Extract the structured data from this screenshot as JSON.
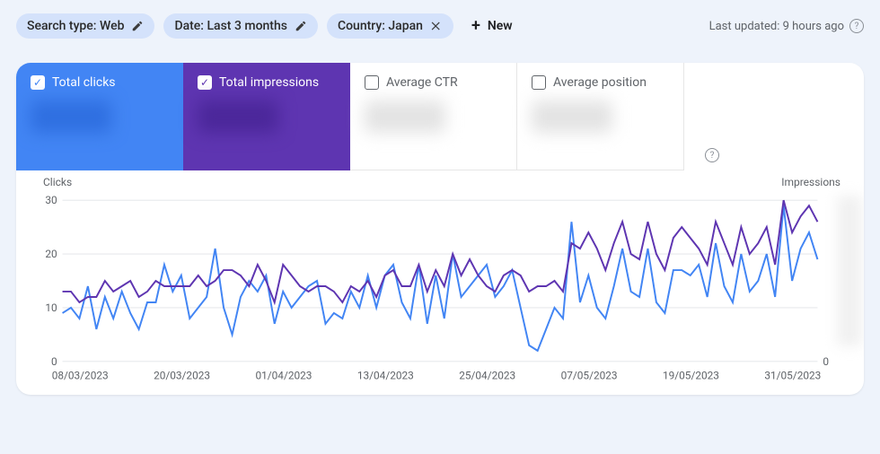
{
  "filters": {
    "search_type": {
      "prefix": "Search type: ",
      "value": "Web"
    },
    "date": {
      "prefix": "Date: ",
      "value": "Last 3 months"
    },
    "country": {
      "prefix": "Country: ",
      "value": "Japan"
    },
    "new_label": "New"
  },
  "status": {
    "last_updated": "Last updated: 9 hours ago"
  },
  "metrics": {
    "clicks": {
      "label": "Total clicks",
      "checked": true,
      "color": "#4285f4"
    },
    "impressions": {
      "label": "Total impressions",
      "checked": true,
      "color": "#5e35b1"
    },
    "ctr": {
      "label": "Average CTR",
      "checked": false
    },
    "position": {
      "label": "Average position",
      "checked": false
    }
  },
  "axes": {
    "left_label": "Clicks",
    "right_label": "Impressions",
    "y_left_ticks": [
      0,
      10,
      20,
      30
    ],
    "y_right_ticks": [
      0
    ],
    "x_ticks": [
      "08/03/2023",
      "20/03/2023",
      "01/04/2023",
      "13/04/2023",
      "25/04/2023",
      "07/05/2023",
      "19/05/2023",
      "31/05/2023"
    ]
  },
  "chart_data": {
    "type": "line",
    "xlabel": "",
    "ylabel": "Clicks",
    "ylim": [
      0,
      30
    ],
    "x": [
      "08/03/2023",
      "09/03/2023",
      "10/03/2023",
      "11/03/2023",
      "12/03/2023",
      "13/03/2023",
      "14/03/2023",
      "15/03/2023",
      "16/03/2023",
      "17/03/2023",
      "18/03/2023",
      "19/03/2023",
      "20/03/2023",
      "21/03/2023",
      "22/03/2023",
      "23/03/2023",
      "24/03/2023",
      "25/03/2023",
      "26/03/2023",
      "27/03/2023",
      "28/03/2023",
      "29/03/2023",
      "30/03/2023",
      "31/03/2023",
      "01/04/2023",
      "02/04/2023",
      "03/04/2023",
      "04/04/2023",
      "05/04/2023",
      "06/04/2023",
      "07/04/2023",
      "08/04/2023",
      "09/04/2023",
      "10/04/2023",
      "11/04/2023",
      "12/04/2023",
      "13/04/2023",
      "14/04/2023",
      "15/04/2023",
      "16/04/2023",
      "17/04/2023",
      "18/04/2023",
      "19/04/2023",
      "20/04/2023",
      "21/04/2023",
      "22/04/2023",
      "23/04/2023",
      "24/04/2023",
      "25/04/2023",
      "26/04/2023",
      "27/04/2023",
      "28/04/2023",
      "29/04/2023",
      "30/04/2023",
      "01/05/2023",
      "02/05/2023",
      "03/05/2023",
      "04/05/2023",
      "05/05/2023",
      "06/05/2023",
      "07/05/2023",
      "08/05/2023",
      "09/05/2023",
      "10/05/2023",
      "11/05/2023",
      "12/05/2023",
      "13/05/2023",
      "14/05/2023",
      "15/05/2023",
      "16/05/2023",
      "17/05/2023",
      "18/05/2023",
      "19/05/2023",
      "20/05/2023",
      "21/05/2023",
      "22/05/2023",
      "23/05/2023",
      "24/05/2023",
      "25/05/2023",
      "26/05/2023",
      "27/05/2023",
      "28/05/2023",
      "29/05/2023",
      "30/05/2023",
      "31/05/2023",
      "01/06/2023",
      "02/06/2023",
      "03/06/2023",
      "04/06/2023",
      "05/06/2023"
    ],
    "series": [
      {
        "name": "Clicks",
        "color": "#4285f4",
        "values": [
          9,
          10,
          8,
          14,
          6,
          12,
          8,
          13,
          9,
          6,
          11,
          11,
          18,
          13,
          16,
          8,
          10,
          12,
          21,
          10,
          5,
          12,
          15,
          13,
          16,
          7,
          13,
          10,
          12,
          14,
          15,
          7,
          9,
          8,
          13,
          10,
          16,
          10,
          16,
          18,
          11,
          8,
          18,
          7,
          16,
          8,
          20,
          12,
          14,
          16,
          18,
          12,
          14,
          17,
          10,
          3,
          2,
          6,
          10,
          8,
          26,
          11,
          16,
          10,
          8,
          14,
          21,
          13,
          12,
          21,
          11,
          9,
          17,
          17,
          16,
          18,
          12,
          22,
          14,
          11,
          20,
          13,
          15,
          20,
          12,
          29,
          15,
          21,
          24,
          19
        ]
      },
      {
        "name": "Impressions",
        "color": "#5e35b1",
        "values": [
          13,
          13,
          11,
          12,
          12,
          15,
          13,
          14,
          15,
          12,
          13,
          15,
          14,
          14,
          14,
          14,
          16,
          14,
          15,
          17,
          17,
          16,
          14,
          18,
          15,
          11,
          18,
          16,
          14,
          13,
          14,
          14,
          13,
          11,
          14,
          13,
          15,
          12,
          16,
          17,
          14,
          14,
          18,
          13,
          17,
          14,
          20,
          16,
          19,
          16,
          14,
          13,
          16,
          17,
          16,
          13,
          14,
          14,
          15,
          13,
          22,
          21,
          24,
          21,
          17,
          22,
          26,
          20,
          19,
          26,
          20,
          17,
          23,
          25,
          23,
          21,
          18,
          26,
          22,
          18,
          25,
          20,
          22,
          25,
          18,
          30,
          24,
          27,
          29,
          26
        ]
      }
    ],
    "x_tick_labels": [
      "08/03/2023",
      "20/03/2023",
      "01/04/2023",
      "13/04/2023",
      "25/04/2023",
      "07/05/2023",
      "19/05/2023",
      "31/05/2023"
    ]
  }
}
